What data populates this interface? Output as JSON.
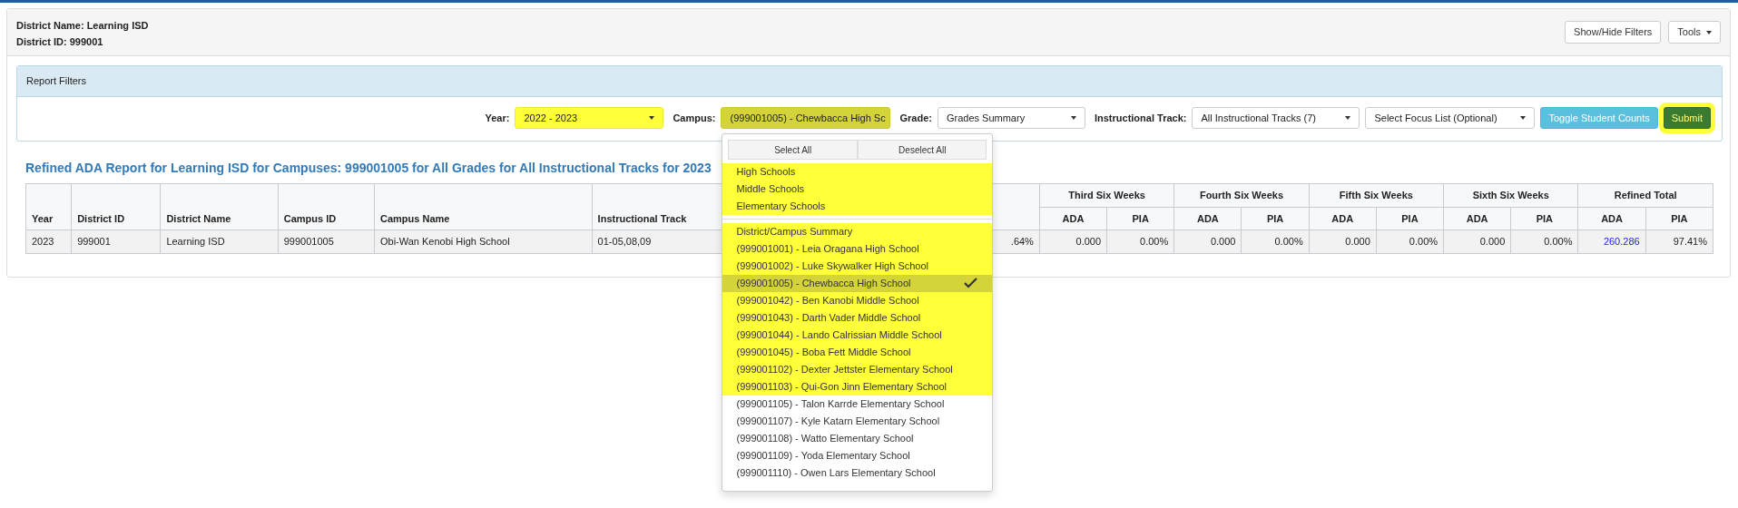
{
  "header": {
    "district_name": "District Name: Learning ISD",
    "district_id": "District ID: 999001"
  },
  "header_buttons": [
    {
      "label": "Show/Hide Filters",
      "kind": "plain"
    },
    {
      "label": "Tools",
      "kind": "dropdown"
    }
  ],
  "filters": {
    "title": "Report Filters",
    "fields": [
      {
        "label": "Year:",
        "value": "2022 - 2023",
        "highlighted": true,
        "expanded": false
      },
      {
        "label": "Campus:",
        "value": "(999001005) - Chewbacca High Sc",
        "highlighted": true,
        "expanded": true
      },
      {
        "label": "Grade:",
        "value": "Grades Summary",
        "highlighted": false,
        "expanded": false
      },
      {
        "label": "Instructional Track:",
        "value": "All Instructional Tracks (7)",
        "highlighted": false,
        "expanded": false
      },
      {
        "value": "Select Focus List (Optional)",
        "highlighted": false,
        "expanded": false
      }
    ],
    "buttons": [
      {
        "label": "Toggle Student Counts",
        "kind": "info",
        "highlighted": false
      },
      {
        "label": "Submit",
        "kind": "success",
        "highlighted": true
      }
    ]
  },
  "campus_dropdown": {
    "actions": [
      "Select All",
      "Deselect All"
    ],
    "groups": [
      {
        "label": "High Schools",
        "highlighted": true
      },
      {
        "label": "Middle Schools",
        "highlighted": true
      },
      {
        "label": "Elementary Schools",
        "highlighted": true
      }
    ],
    "items": [
      {
        "label": "District/Campus Summary",
        "selected": false,
        "highlighted": true
      },
      {
        "label": "(999001001) - Leia Oragana High School",
        "selected": false,
        "highlighted": true
      },
      {
        "label": "(999001002) - Luke Skywalker High School",
        "selected": false,
        "highlighted": true
      },
      {
        "label": "(999001005) - Chewbacca High School",
        "selected": true,
        "highlighted": true
      },
      {
        "label": "(999001042) - Ben Kanobi Middle School",
        "selected": false,
        "highlighted": true
      },
      {
        "label": "(999001043) - Darth Vader Middle School",
        "selected": false,
        "highlighted": true
      },
      {
        "label": "(999001044) - Lando Calrissian Middle School",
        "selected": false,
        "highlighted": true
      },
      {
        "label": "(999001045) - Boba Fett Middle School",
        "selected": false,
        "highlighted": true
      },
      {
        "label": "(999001102) - Dexter Jettster Elementary School",
        "selected": false,
        "highlighted": true
      },
      {
        "label": "(999001103) - Qui-Gon Jinn Elementary School",
        "selected": false,
        "highlighted": true
      },
      {
        "label": "(999001105) - Talon Karrde Elementary School",
        "selected": false,
        "highlighted": false
      },
      {
        "label": "(999001107) - Kyle Katarn Elementary School",
        "selected": false,
        "highlighted": false
      },
      {
        "label": "(999001108) - Watto Elementary School",
        "selected": false,
        "highlighted": false
      },
      {
        "label": "(999001109) - Yoda Elementary School",
        "selected": false,
        "highlighted": false
      },
      {
        "label": "(999001110) - Owen Lars Elementary School",
        "selected": false,
        "highlighted": false
      }
    ]
  },
  "report": {
    "title": "Refined ADA Report for Learning ISD for Campuses: 999001005 for All Grades for All Instructional Tracks for 2023",
    "columns": [
      "Year",
      "District ID",
      "District Name",
      "Campus ID",
      "Campus Name",
      "Instructional Track"
    ],
    "groups": [
      {
        "label": "Third Six Weeks",
        "subcolumns": [
          "ADA",
          "PIA"
        ]
      },
      {
        "label": "Fourth Six Weeks",
        "subcolumns": [
          "ADA",
          "PIA"
        ]
      },
      {
        "label": "Fifth Six Weeks",
        "subcolumns": [
          "ADA",
          "PIA"
        ]
      },
      {
        "label": "Sixth Six Weeks",
        "subcolumns": [
          "ADA",
          "PIA"
        ]
      },
      {
        "label": "Refined Total",
        "subcolumns": [
          "ADA",
          "PIA"
        ]
      }
    ],
    "rows": [
      {
        "cells": [
          "2023",
          "999001",
          "Learning ISD",
          "999001005",
          "Obi-Wan Kenobi High School",
          "01-05,08,09"
        ],
        "column_7": ".64%",
        "group_values": [
          [
            {
              "text": "0.000",
              "kind": "number"
            },
            {
              "text": "0.00%",
              "kind": "number"
            }
          ],
          [
            {
              "text": "0.000",
              "kind": "number"
            },
            {
              "text": "0.00%",
              "kind": "number"
            }
          ],
          [
            {
              "text": "0.000",
              "kind": "number"
            },
            {
              "text": "0.00%",
              "kind": "number"
            }
          ],
          [
            {
              "text": "0.000",
              "kind": "number"
            },
            {
              "text": "0.00%",
              "kind": "number"
            }
          ],
          [
            {
              "text": "260.286",
              "kind": "link"
            },
            {
              "text": "97.41%",
              "kind": "number"
            }
          ]
        ]
      }
    ]
  }
}
